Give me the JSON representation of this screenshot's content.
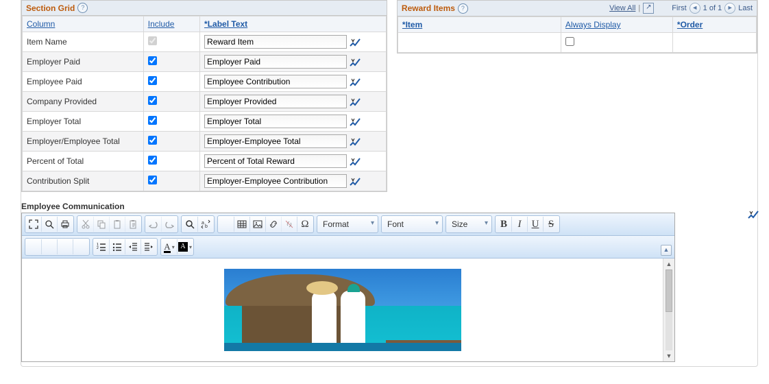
{
  "section_grid": {
    "title": "Section Grid",
    "headers": {
      "column": "Column",
      "include": "Include",
      "label_text": "*Label Text"
    },
    "rows": [
      {
        "column": "Item Name",
        "include": true,
        "disabled": true,
        "label": "Reward Item"
      },
      {
        "column": "Employer Paid",
        "include": true,
        "disabled": false,
        "label": "Employer Paid"
      },
      {
        "column": "Employee Paid",
        "include": true,
        "disabled": false,
        "label": "Employee Contribution"
      },
      {
        "column": "Company Provided",
        "include": true,
        "disabled": false,
        "label": "Employer Provided"
      },
      {
        "column": "Employer Total",
        "include": true,
        "disabled": false,
        "label": "Employer Total"
      },
      {
        "column": "Employer/Employee Total",
        "include": true,
        "disabled": false,
        "label": "Employer-Employee Total"
      },
      {
        "column": "Percent of Total",
        "include": true,
        "disabled": false,
        "label": "Percent of Total Reward"
      },
      {
        "column": "Contribution Split",
        "include": true,
        "disabled": false,
        "label": "Employer-Employee Contribution"
      }
    ]
  },
  "reward_items": {
    "title": "Reward Items",
    "view_all": "View All",
    "first": "First",
    "paging": "1 of 1",
    "last": "Last",
    "headers": {
      "item": "*Item",
      "always_display": "Always Display",
      "order": "*Order"
    },
    "rows": [
      {
        "item": "",
        "always_display": false,
        "order": ""
      }
    ]
  },
  "communication": {
    "label": "Employee Communication",
    "dropdowns": {
      "format": "Format",
      "font": "Font",
      "size": "Size"
    }
  }
}
